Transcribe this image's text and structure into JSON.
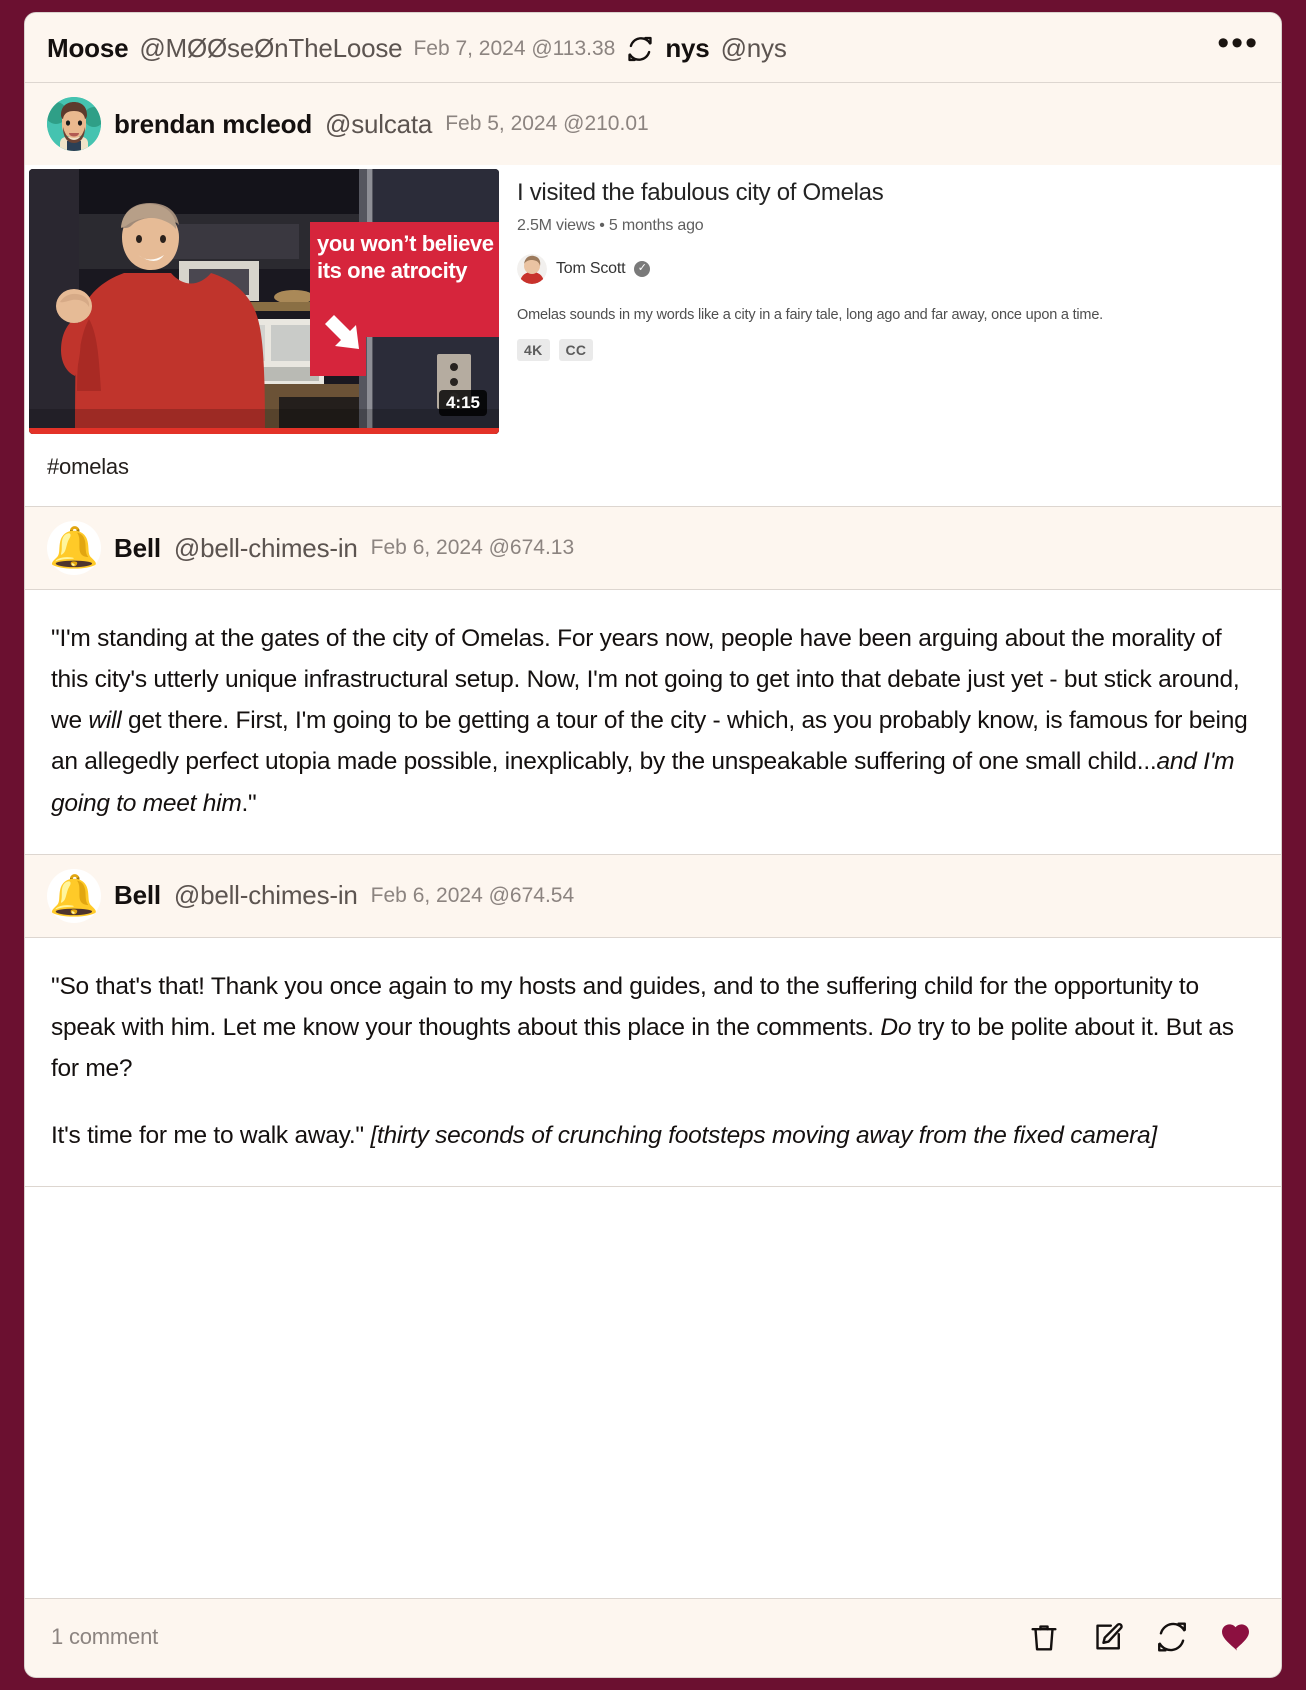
{
  "theme": {
    "page_bg": "#6b1030",
    "card_bg": "#ffffff",
    "header_bg": "#fdf6ef",
    "accent_heart": "#8c1040",
    "muted_text": "#8c8480",
    "body_text": "#14100f"
  },
  "boost": {
    "display_name": "Moose",
    "handle": "@MØØseØnTheLoose",
    "timestamp": "Feb 7, 2024 @113.38",
    "repost_icon": "repost-icon",
    "boosted_name": "nys",
    "boosted_handle": "@nys",
    "more_icon": "•••"
  },
  "quoted_post": {
    "avatar_icon": "user-avatar-illustration",
    "display_name": "brendan mcleod",
    "handle": "@sulcata",
    "timestamp": "Feb 5, 2024 @210.01",
    "hashtag": "#omelas",
    "link_preview": {
      "thumbnail_alt": "man in red shirt in kitchen with red caption overlay",
      "thumbnail_caption_line1": "you won’t believe",
      "thumbnail_caption_line2": "its one atrocity",
      "duration": "4:15",
      "title": "I visited the fabulous city of Omelas",
      "stats": "2.5M views • 5 months ago",
      "channel": "Tom Scott",
      "verified": true,
      "description": "Omelas sounds in my words like a city in a fairy tale, long ago and far away, once upon a time.",
      "badges": [
        "4K",
        "CC"
      ]
    }
  },
  "replies": [
    {
      "avatar_icon": "bell-emoji-avatar",
      "display_name": "Bell",
      "handle": "@bell-chimes-in",
      "timestamp": "Feb 6, 2024 @674.13",
      "paragraphs": [
        {
          "runs": [
            {
              "text": "\"I'm standing at the gates of the city of Omelas. For years now, people have been arguing about the morality of this city's utterly unique infrastructural setup. Now, I'm not going to get into that debate just yet - but stick around, we ",
              "italic": false
            },
            {
              "text": "will",
              "italic": true
            },
            {
              "text": " get there. First, I'm going to be getting a tour of the city - which, as you probably know, is famous for being an allegedly perfect utopia made possible, inexplicably, by the unspeakable suffering of one small child...",
              "italic": false
            },
            {
              "text": "and I'm going to meet him",
              "italic": true
            },
            {
              "text": ".\"",
              "italic": false
            }
          ]
        }
      ]
    },
    {
      "avatar_icon": "bell-emoji-avatar",
      "display_name": "Bell",
      "handle": "@bell-chimes-in",
      "timestamp": "Feb 6, 2024 @674.54",
      "paragraphs": [
        {
          "runs": [
            {
              "text": "\"So that's that! Thank you once again to my hosts and guides, and to the suffering child for the opportunity to speak with him. Let me know your thoughts about this place in the comments. ",
              "italic": false
            },
            {
              "text": "Do",
              "italic": true
            },
            {
              "text": " try to be polite about it. But as for me?",
              "italic": false
            }
          ]
        },
        {
          "runs": [
            {
              "text": "It's time for me to walk away.\" ",
              "italic": false
            },
            {
              "text": "[thirty seconds of crunching footsteps moving away from the fixed camera]",
              "italic": true
            }
          ]
        }
      ]
    }
  ],
  "footer": {
    "comment_count": "1 comment",
    "actions": [
      {
        "name": "delete-icon",
        "label": "Delete"
      },
      {
        "name": "edit-icon",
        "label": "Edit"
      },
      {
        "name": "repost-icon",
        "label": "Repost"
      },
      {
        "name": "heart-icon",
        "label": "Favourite",
        "active": true
      }
    ]
  }
}
